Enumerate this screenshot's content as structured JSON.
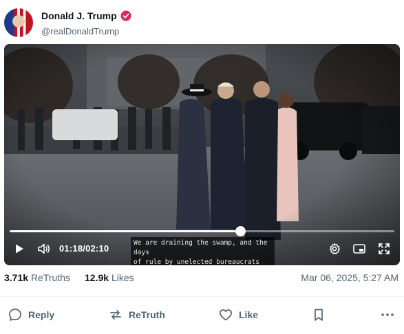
{
  "post": {
    "author": {
      "display_name": "Donald J. Trump",
      "handle": "@realDonaldTrump",
      "verified": true,
      "verified_color": "#e0245e"
    },
    "video": {
      "current_time": "01:18",
      "duration": "02:10",
      "progress": 0.6,
      "caption_line1": "We are draining the swamp, and the days",
      "caption_line2": "of rule by unelected bureaucrats are over."
    },
    "stats": {
      "retruths_count": "3.71k",
      "retruths_label": "ReTruths",
      "likes_count": "12.9k",
      "likes_label": "Likes",
      "timestamp": "Mar 06, 2025, 5:27 AM"
    },
    "actions": {
      "reply_label": "Reply",
      "retruth_label": "ReTruth",
      "like_label": "Like"
    }
  },
  "icons": {
    "play": "play-icon",
    "volume": "volume-icon",
    "settings": "gear-icon",
    "pip": "picture-in-picture-icon",
    "fullscreen": "fullscreen-icon",
    "reply": "speech-bubble-icon",
    "retruth": "repost-arrows-icon",
    "like": "heart-icon",
    "bookmark": "bookmark-icon",
    "more": "more-dots-icon"
  }
}
